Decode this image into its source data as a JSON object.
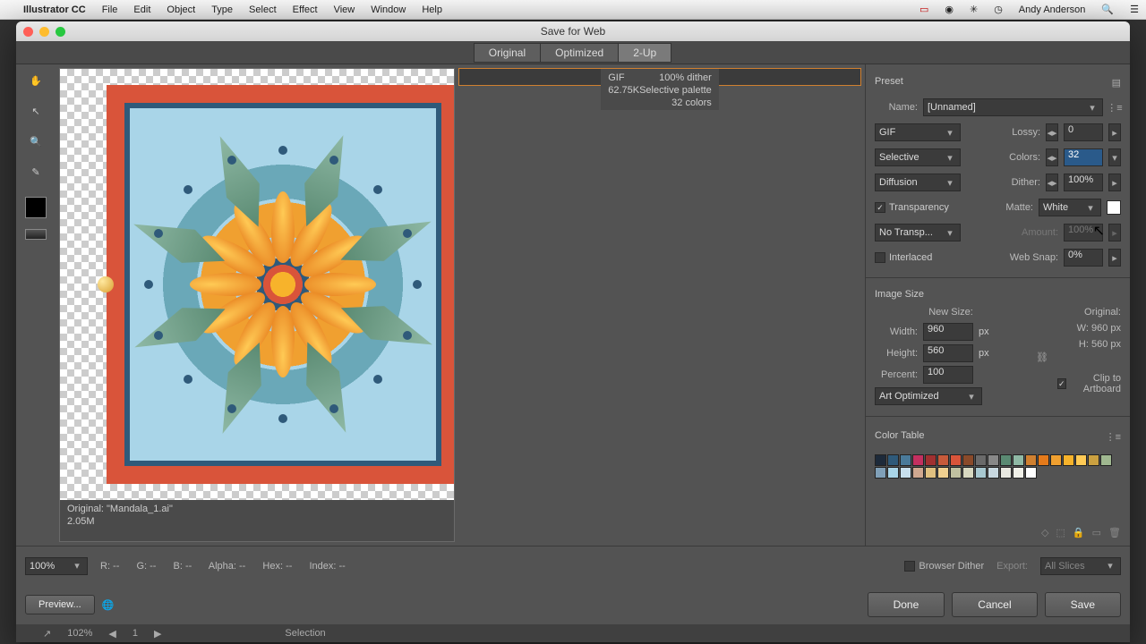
{
  "menubar": {
    "app": "Illustrator CC",
    "items": [
      "File",
      "Edit",
      "Object",
      "Type",
      "Select",
      "Effect",
      "View",
      "Window",
      "Help"
    ],
    "user": "Andy Anderson"
  },
  "dialog": {
    "title": "Save for Web"
  },
  "tabs": {
    "original": "Original",
    "optimized": "Optimized",
    "two_up": "2-Up"
  },
  "preview": {
    "left": {
      "line1": "Original: \"Mandala_1.ai\"",
      "line2": "2.05M"
    },
    "right": {
      "line1": "GIF",
      "line2": "62.75K",
      "r1": "100% dither",
      "r2": "Selective palette",
      "r3": "32 colors"
    }
  },
  "preset": {
    "section": "Preset",
    "name_label": "Name:",
    "name_value": "[Unnamed]",
    "format": "GIF",
    "lossy_label": "Lossy:",
    "lossy_value": "0",
    "reduction": "Selective",
    "colors_label": "Colors:",
    "colors_value": "32",
    "dither_method": "Diffusion",
    "dither_label": "Dither:",
    "dither_value": "100%",
    "transparency_label": "Transparency",
    "matte_label": "Matte:",
    "matte_value": "White",
    "trans_dither": "No Transp...",
    "amount_label": "Amount:",
    "amount_value": "100%",
    "interlaced_label": "Interlaced",
    "websnap_label": "Web Snap:",
    "websnap_value": "0%"
  },
  "imagesize": {
    "section": "Image Size",
    "newsize": "New Size:",
    "original": "Original:",
    "width_label": "Width:",
    "width_value": "960",
    "px": "px",
    "height_label": "Height:",
    "height_value": "560",
    "percent_label": "Percent:",
    "percent_value": "100",
    "orig_w": "W: 960 px",
    "orig_h": "H: 560 px",
    "quality": "Art Optimized",
    "clip_label": "Clip to Artboard"
  },
  "colortable": {
    "section": "Color Table",
    "colors": [
      "#1d2a3a",
      "#2f5a7a",
      "#4a7a9a",
      "#c43060",
      "#a03030",
      "#c75a3a",
      "#d9543a",
      "#8a4a2a",
      "#6a6a6a",
      "#888888",
      "#5a8a72",
      "#8fb9a5",
      "#d08030",
      "#e57a1a",
      "#f0a030",
      "#f7b32b",
      "#ffca55",
      "#caa040",
      "#a0b890",
      "#80a0b8",
      "#a9d5e8",
      "#c8e0ee",
      "#d0a890",
      "#e0c080",
      "#f0d090",
      "#c0c0a0",
      "#d8d8c0",
      "#a8c8d0",
      "#c8d8e0",
      "#e8e8e0",
      "#f0f0e8",
      "#ffffff"
    ]
  },
  "footer": {
    "zoom": "100%",
    "r": "R: --",
    "g": "G: --",
    "b": "B: --",
    "alpha": "Alpha: --",
    "hex": "Hex: --",
    "index": "Index: --",
    "browser_dither": "Browser Dither",
    "export": "Export:",
    "slices": "All Slices",
    "preview": "Preview...",
    "done": "Done",
    "cancel": "Cancel",
    "save": "Save"
  },
  "status": {
    "zoom": "102%",
    "page": "1",
    "tool": "Selection"
  }
}
